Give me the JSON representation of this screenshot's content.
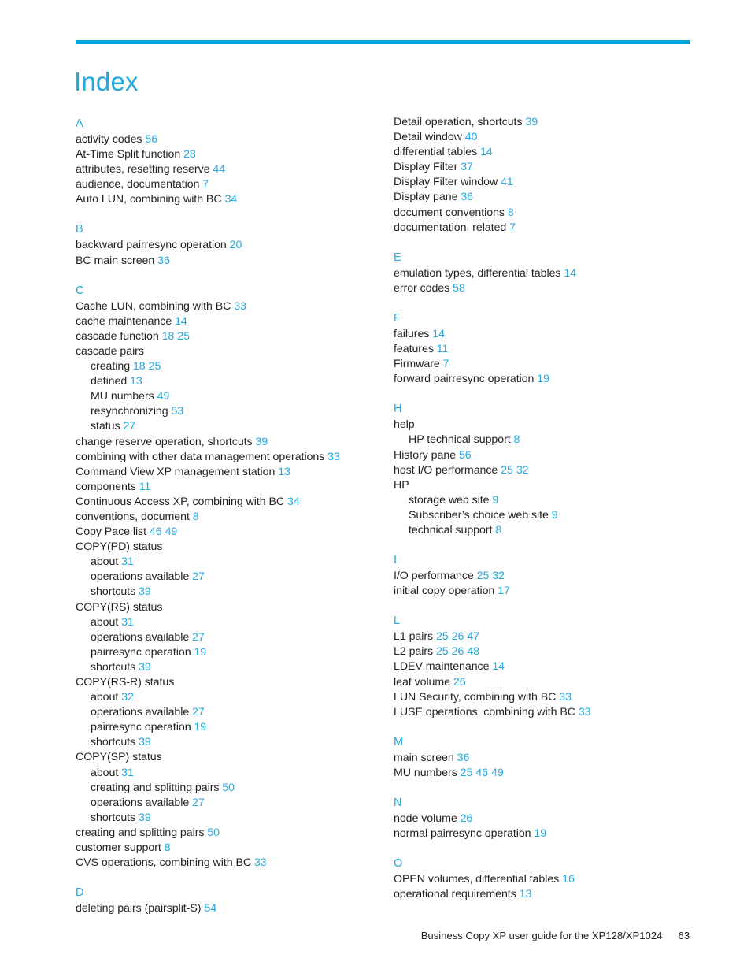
{
  "document": {
    "title": "Index",
    "accent_color": "#00a0df",
    "text_color": "#231f20",
    "page_number_color": "#23a8e0"
  },
  "footer": {
    "guide_title": "Business Copy XP user guide for the XP128/XP1024",
    "page_number": "63"
  },
  "columns": [
    {
      "id": "left",
      "sections": [
        {
          "letter": "A",
          "entries": [
            {
              "text": "activity codes",
              "pages": [
                "56"
              ],
              "level": 0
            },
            {
              "text": "At-Time Split function",
              "pages": [
                "28"
              ],
              "level": 0
            },
            {
              "text": "attributes, resetting reserve",
              "pages": [
                "44"
              ],
              "level": 0
            },
            {
              "text": "audience, documentation",
              "pages": [
                "7"
              ],
              "level": 0
            },
            {
              "text": "Auto LUN, combining with BC",
              "pages": [
                "34"
              ],
              "level": 0
            }
          ]
        },
        {
          "letter": "B",
          "entries": [
            {
              "text": "backward pairresync operation",
              "pages": [
                "20"
              ],
              "level": 0
            },
            {
              "text": "BC main screen",
              "pages": [
                "36"
              ],
              "level": 0
            }
          ]
        },
        {
          "letter": "C",
          "entries": [
            {
              "text": "Cache LUN, combining with BC",
              "pages": [
                "33"
              ],
              "level": 0
            },
            {
              "text": "cache maintenance",
              "pages": [
                "14"
              ],
              "level": 0
            },
            {
              "text": "cascade function",
              "pages": [
                "18",
                "25"
              ],
              "level": 0
            },
            {
              "text": "cascade pairs",
              "pages": [],
              "level": 0
            },
            {
              "text": "creating",
              "pages": [
                "18",
                "25"
              ],
              "level": 1
            },
            {
              "text": "defined",
              "pages": [
                "13"
              ],
              "level": 1
            },
            {
              "text": "MU numbers",
              "pages": [
                "49"
              ],
              "level": 1
            },
            {
              "text": "resynchronizing",
              "pages": [
                "53"
              ],
              "level": 1
            },
            {
              "text": "status",
              "pages": [
                "27"
              ],
              "level": 1
            },
            {
              "text": "change reserve operation, shortcuts",
              "pages": [
                "39"
              ],
              "level": 0
            },
            {
              "text": "combining with other data management operations",
              "pages": [
                "33"
              ],
              "level": 0
            },
            {
              "text": "Command View XP management station",
              "pages": [
                "13"
              ],
              "level": 0
            },
            {
              "text": "components",
              "pages": [
                "11"
              ],
              "level": 0
            },
            {
              "text": "Continuous Access XP, combining with BC",
              "pages": [
                "34"
              ],
              "level": 0
            },
            {
              "text": "conventions, document",
              "pages": [
                "8"
              ],
              "level": 0
            },
            {
              "text": "Copy Pace list",
              "pages": [
                "46",
                "49"
              ],
              "level": 0
            },
            {
              "text": "COPY(PD) status",
              "pages": [],
              "level": 0
            },
            {
              "text": "about",
              "pages": [
                "31"
              ],
              "level": 1
            },
            {
              "text": "operations available",
              "pages": [
                "27"
              ],
              "level": 1
            },
            {
              "text": "shortcuts",
              "pages": [
                "39"
              ],
              "level": 1
            },
            {
              "text": "COPY(RS) status",
              "pages": [],
              "level": 0
            },
            {
              "text": "about",
              "pages": [
                "31"
              ],
              "level": 1
            },
            {
              "text": "operations available",
              "pages": [
                "27"
              ],
              "level": 1
            },
            {
              "text": "pairresync operation",
              "pages": [
                "19"
              ],
              "level": 1
            },
            {
              "text": "shortcuts",
              "pages": [
                "39"
              ],
              "level": 1
            },
            {
              "text": "COPY(RS-R) status",
              "pages": [],
              "level": 0
            },
            {
              "text": "about",
              "pages": [
                "32"
              ],
              "level": 1
            },
            {
              "text": "operations available",
              "pages": [
                "27"
              ],
              "level": 1
            },
            {
              "text": "pairresync operation",
              "pages": [
                "19"
              ],
              "level": 1
            },
            {
              "text": "shortcuts",
              "pages": [
                "39"
              ],
              "level": 1
            },
            {
              "text": "COPY(SP) status",
              "pages": [],
              "level": 0
            },
            {
              "text": "about",
              "pages": [
                "31"
              ],
              "level": 1
            },
            {
              "text": "creating and splitting pairs",
              "pages": [
                "50"
              ],
              "level": 1
            },
            {
              "text": "operations available",
              "pages": [
                "27"
              ],
              "level": 1
            },
            {
              "text": "shortcuts",
              "pages": [
                "39"
              ],
              "level": 1
            },
            {
              "text": "creating and splitting pairs",
              "pages": [
                "50"
              ],
              "level": 0
            },
            {
              "text": "customer support",
              "pages": [
                "8"
              ],
              "level": 0
            },
            {
              "text": "CVS operations, combining with BC",
              "pages": [
                "33"
              ],
              "level": 0
            }
          ]
        },
        {
          "letter": "D",
          "entries": [
            {
              "text": "deleting pairs (pairsplit-S)",
              "pages": [
                "54"
              ],
              "level": 0
            }
          ]
        }
      ]
    },
    {
      "id": "right",
      "sections": [
        {
          "letter": "",
          "entries": [
            {
              "text": "Detail operation, shortcuts",
              "pages": [
                "39"
              ],
              "level": 0
            },
            {
              "text": "Detail window",
              "pages": [
                "40"
              ],
              "level": 0
            },
            {
              "text": "differential tables",
              "pages": [
                "14"
              ],
              "level": 0
            },
            {
              "text": "Display Filter",
              "pages": [
                "37"
              ],
              "level": 0
            },
            {
              "text": "Display Filter window",
              "pages": [
                "41"
              ],
              "level": 0
            },
            {
              "text": "Display pane",
              "pages": [
                "36"
              ],
              "level": 0
            },
            {
              "text": "document conventions",
              "pages": [
                "8"
              ],
              "level": 0
            },
            {
              "text": "documentation, related",
              "pages": [
                "7"
              ],
              "level": 0
            }
          ]
        },
        {
          "letter": "E",
          "entries": [
            {
              "text": "emulation types, differential tables",
              "pages": [
                "14"
              ],
              "level": 0
            },
            {
              "text": "error codes",
              "pages": [
                "58"
              ],
              "level": 0
            }
          ]
        },
        {
          "letter": "F",
          "entries": [
            {
              "text": "failures",
              "pages": [
                "14"
              ],
              "level": 0
            },
            {
              "text": "features",
              "pages": [
                "11"
              ],
              "level": 0
            },
            {
              "text": "Firmware",
              "pages": [
                "7"
              ],
              "level": 0
            },
            {
              "text": "forward pairresync operation",
              "pages": [
                "19"
              ],
              "level": 0
            }
          ]
        },
        {
          "letter": "H",
          "entries": [
            {
              "text": "help",
              "pages": [],
              "level": 0
            },
            {
              "text": "HP technical support",
              "pages": [
                "8"
              ],
              "level": 1
            },
            {
              "text": "History pane",
              "pages": [
                "56"
              ],
              "level": 0
            },
            {
              "text": "host I/O performance",
              "pages": [
                "25",
                "32"
              ],
              "level": 0
            },
            {
              "text": "HP",
              "pages": [],
              "level": 0
            },
            {
              "text": "storage web site",
              "pages": [
                "9"
              ],
              "level": 1
            },
            {
              "text": "Subscriber’s choice web site",
              "pages": [
                "9"
              ],
              "level": 1
            },
            {
              "text": "technical support",
              "pages": [
                "8"
              ],
              "level": 1
            }
          ]
        },
        {
          "letter": "I",
          "entries": [
            {
              "text": "I/O performance",
              "pages": [
                "25",
                "32"
              ],
              "level": 0
            },
            {
              "text": "initial copy operation",
              "pages": [
                "17"
              ],
              "level": 0
            }
          ]
        },
        {
          "letter": "L",
          "entries": [
            {
              "text": "L1 pairs",
              "pages": [
                "25",
                "26",
                "47"
              ],
              "level": 0
            },
            {
              "text": "L2 pairs",
              "pages": [
                "25",
                "26",
                "48"
              ],
              "level": 0
            },
            {
              "text": "LDEV maintenance",
              "pages": [
                "14"
              ],
              "level": 0
            },
            {
              "text": "leaf volume",
              "pages": [
                "26"
              ],
              "level": 0
            },
            {
              "text": "LUN Security, combining with BC",
              "pages": [
                "33"
              ],
              "level": 0
            },
            {
              "text": "LUSE operations, combining with BC",
              "pages": [
                "33"
              ],
              "level": 0
            }
          ]
        },
        {
          "letter": "M",
          "entries": [
            {
              "text": "main screen",
              "pages": [
                "36"
              ],
              "level": 0
            },
            {
              "text": "MU numbers",
              "pages": [
                "25",
                "46",
                "49"
              ],
              "level": 0
            }
          ]
        },
        {
          "letter": "N",
          "entries": [
            {
              "text": "node volume",
              "pages": [
                "26"
              ],
              "level": 0
            },
            {
              "text": "normal pairresync operation",
              "pages": [
                "19"
              ],
              "level": 0
            }
          ]
        },
        {
          "letter": "O",
          "entries": [
            {
              "text": "OPEN volumes, differential tables",
              "pages": [
                "16"
              ],
              "level": 0
            },
            {
              "text": "operational requirements",
              "pages": [
                "13"
              ],
              "level": 0
            }
          ]
        }
      ]
    }
  ]
}
